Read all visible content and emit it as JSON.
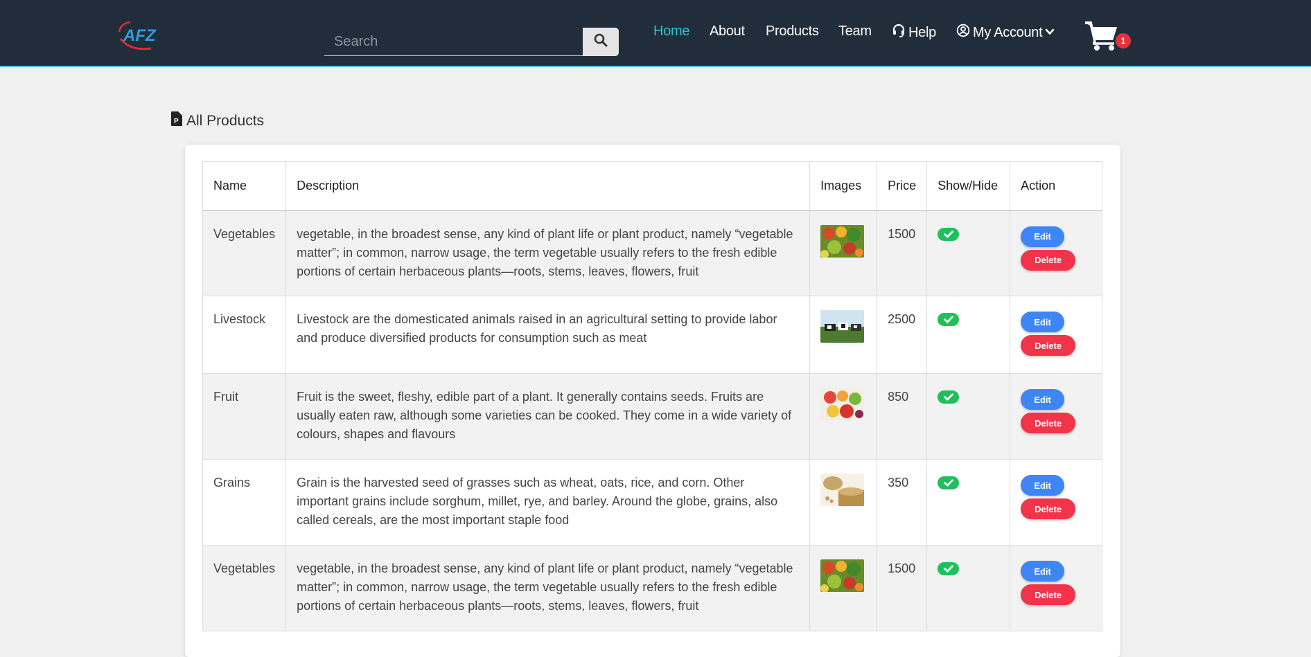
{
  "brand": {
    "logo_text": "AFZ"
  },
  "search": {
    "placeholder": "Search"
  },
  "nav": {
    "links": [
      {
        "label": "Home",
        "active": true
      },
      {
        "label": "About",
        "active": false
      },
      {
        "label": "Products",
        "active": false
      },
      {
        "label": "Team",
        "active": false
      },
      {
        "label": "Help",
        "icon": "headset-icon",
        "active": false
      },
      {
        "label": "My Account",
        "icon": "user-circle-icon",
        "dropdown": true,
        "active": false
      }
    ]
  },
  "cart": {
    "count": "1",
    "icon": "shopping-cart-icon"
  },
  "page": {
    "title": "All Products",
    "title_icon": "product-file-icon"
  },
  "table": {
    "columns": [
      "Name",
      "Description",
      "Images",
      "Price",
      "Show/Hide",
      "Action"
    ],
    "rows": [
      {
        "name": "Vegetables",
        "description": "vegetable, in the broadest sense, any kind of plant life or plant product, namely “vegetable matter”; in common, narrow usage, the term vegetable usually refers to the fresh edible portions of certain herbaceous plants—roots, stems, leaves, flowers, fruit",
        "image": "vegetables-image",
        "price": "1500",
        "visible": true
      },
      {
        "name": "Livestock",
        "description": "Livestock are the domesticated animals raised in an agricultural setting to provide labor and produce diversified products for consumption such as meat",
        "image": "livestock-image",
        "price": "2500",
        "visible": true
      },
      {
        "name": "Fruit",
        "description": "Fruit is the sweet, fleshy, edible part of a plant. It generally contains seeds. Fruits are usually eaten raw, although some varieties can be cooked. They come in a wide variety of colours, shapes and flavours",
        "image": "fruit-image",
        "price": "850",
        "visible": true
      },
      {
        "name": "Grains",
        "description": "Grain is the harvested seed of grasses such as wheat, oats, rice, and corn. Other important grains include sorghum, millet, rye, and barley. Around the globe, grains, also called cereals, are the most important staple food",
        "image": "grains-image",
        "price": "350",
        "visible": true
      },
      {
        "name": "Vegetables",
        "description": "vegetable, in the broadest sense, any kind of plant life or plant product, namely “vegetable matter”; in common, narrow usage, the term vegetable usually refers to the fresh edible portions of certain herbaceous plants—roots, stems, leaves, flowers, fruit",
        "image": "vegetables-image",
        "price": "1500",
        "visible": true
      }
    ],
    "actions": {
      "edit_label": "Edit",
      "delete_label": "Delete"
    }
  },
  "colors": {
    "navbar_bg": "#222d3c",
    "accent": "#35c0d6",
    "toggle_on": "#1ec05b",
    "edit_btn": "#3e86f5",
    "delete_btn": "#f2344a",
    "badge": "#e8303c"
  }
}
